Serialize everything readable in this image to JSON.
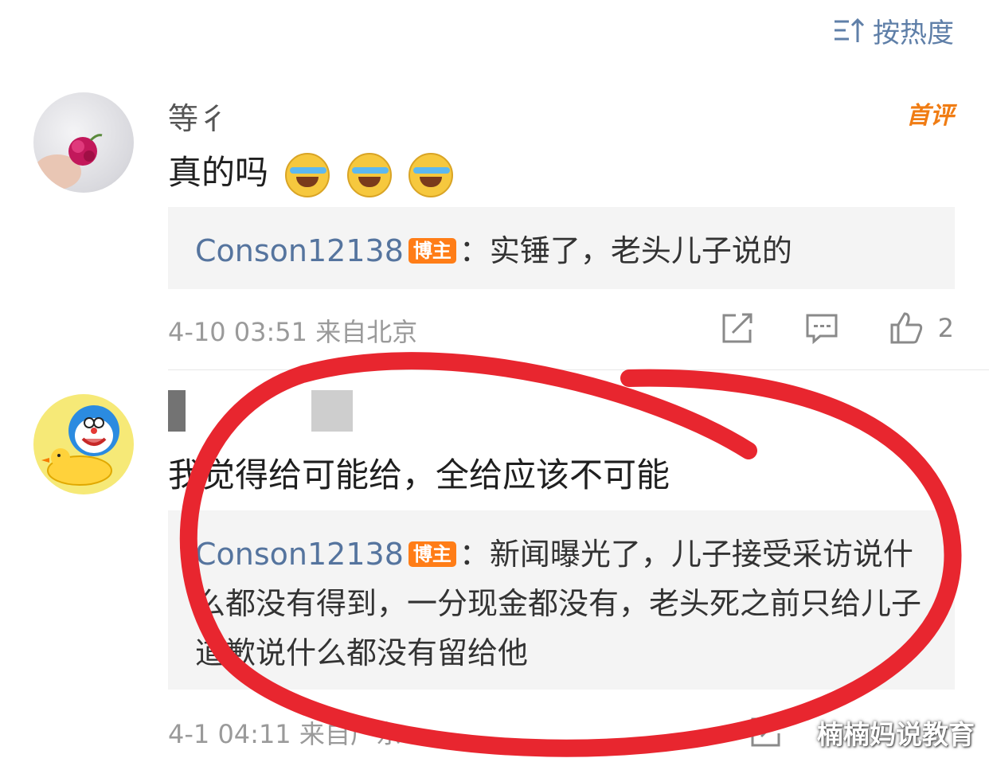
{
  "sort": {
    "label": "按热度",
    "icon": "sort-icon"
  },
  "comments": [
    {
      "username": "等彳",
      "badge": "首评",
      "text": "真的吗",
      "emoji_count": 3,
      "reply": {
        "author": "Conson12138",
        "author_badge": "博主",
        "text": "：实锤了，老头儿子说的"
      },
      "meta": "4-10 03:51 来自北京",
      "likes": "2"
    },
    {
      "username": "",
      "text": "我觉得给可能给，全给应该不可能",
      "reply": {
        "author": "Conson12138",
        "author_badge": "博主",
        "text": "：新闻曝光了，儿子接受采访说什么都没有得到，一分现金都没有，老头死之前只给儿子道歉说什么都没有留给他"
      },
      "meta": "4-1  04:11 来自广东"
    }
  ],
  "watermark": "楠楠妈说教育",
  "colors": {
    "accent_link": "#55749e",
    "badge_orange": "#ff7d17",
    "annotation_red": "#e8262f"
  }
}
